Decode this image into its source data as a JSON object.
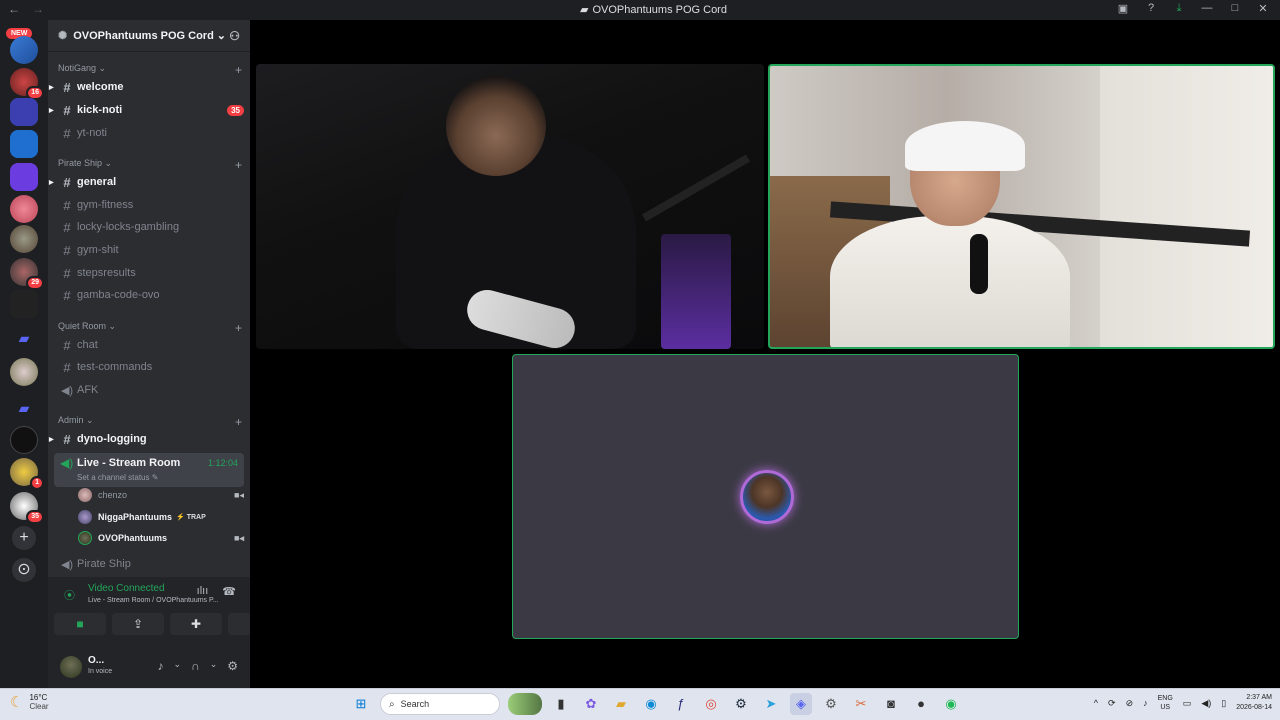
{
  "titlebar": {
    "back": "←",
    "forward": "→",
    "title": "OVOPhantuums POG Cord",
    "icons": [
      "inbox-icon",
      "help-icon",
      "download-icon",
      "minimize-icon",
      "maximize-icon",
      "close-icon"
    ]
  },
  "server_rail": {
    "new_badge": "NEW",
    "badges": [
      "16",
      "29",
      "1",
      "35"
    ]
  },
  "server": {
    "name": "OVOPhantuums POG Cord",
    "chevron": "⌄"
  },
  "categories": [
    {
      "name": "NotiGang ⌄",
      "channels": [
        {
          "name": "welcome",
          "unread": true
        },
        {
          "name": "kick-noti",
          "unread": true,
          "mentions": "35"
        },
        {
          "name": "yt-noti",
          "unread": false
        }
      ]
    },
    {
      "name": "Pirate Ship ⌄",
      "channels": [
        {
          "name": "general",
          "unread": true
        },
        {
          "name": "gym-fitness",
          "unread": false
        },
        {
          "name": "locky-locks-gambling",
          "unread": false
        },
        {
          "name": "gym-shit",
          "unread": false
        },
        {
          "name": "stepsresults",
          "unread": false
        },
        {
          "name": "gamba-code-ovo",
          "unread": false
        }
      ]
    },
    {
      "name": "Quiet Room ⌄",
      "channels": [
        {
          "name": "chat",
          "unread": false
        },
        {
          "name": "test-commands",
          "unread": false
        },
        {
          "name": "AFK",
          "unread": false,
          "voice": true
        }
      ]
    },
    {
      "name": "Admin ⌄",
      "channels": [
        {
          "name": "dyno-logging",
          "unread": true
        }
      ]
    }
  ],
  "live_voice": {
    "name": "Live - Stream Room",
    "timer": "1:12:04",
    "status": "Set a channel status",
    "users": [
      {
        "name": "chenzo",
        "camera": true
      },
      {
        "name": "NiggaPhantuums",
        "tag": "TRAP",
        "camera": false
      },
      {
        "name": "OVOPhantuums",
        "camera": true
      }
    ]
  },
  "pirate_voice": "Pirate Ship",
  "voice_panel": {
    "status": "Video Connected",
    "location": "Live - Stream Room / OVOPhantuums P..."
  },
  "user_panel": {
    "name": "O...",
    "status": "In voice"
  },
  "taskbar": {
    "temp": "16°C",
    "condition": "Clear",
    "search_placeholder": "Search",
    "lang_top": "ENG",
    "lang_bottom": "US",
    "time": "2:37 AM",
    "date": "2026-08-14"
  },
  "colors": {
    "accent_green": "#23a55a",
    "mention_red": "#f23f43",
    "speaking_purple": "#b06ad8"
  }
}
